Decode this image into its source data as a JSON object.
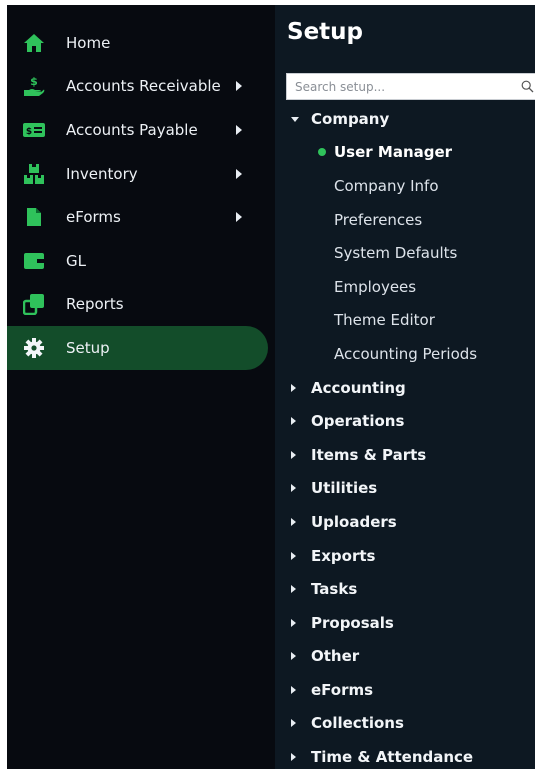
{
  "colors": {
    "accent": "#2fc25b",
    "sidebar_bg": "#070a10",
    "main_bg": "#0d1822",
    "active_item_bg": "#134d2a"
  },
  "sidebar": {
    "items": [
      {
        "label": "Home",
        "icon": "home-icon",
        "has_submenu": false,
        "active": false
      },
      {
        "label": "Accounts Receivable",
        "icon": "hand-dollar-icon",
        "has_submenu": true,
        "active": false
      },
      {
        "label": "Accounts Payable",
        "icon": "money-bill-icon",
        "has_submenu": true,
        "active": false
      },
      {
        "label": "Inventory",
        "icon": "boxes-icon",
        "has_submenu": true,
        "active": false
      },
      {
        "label": "eForms",
        "icon": "file-icon",
        "has_submenu": true,
        "active": false
      },
      {
        "label": "GL",
        "icon": "wallet-icon",
        "has_submenu": false,
        "active": false
      },
      {
        "label": "Reports",
        "icon": "reports-icon",
        "has_submenu": false,
        "active": false
      },
      {
        "label": "Setup",
        "icon": "gear-icon",
        "has_submenu": false,
        "active": true
      }
    ]
  },
  "main": {
    "title": "Setup",
    "search": {
      "placeholder": "Search setup...",
      "value": ""
    },
    "tree": [
      {
        "label": "Company",
        "expanded": true,
        "children": [
          {
            "label": "User Manager",
            "active": true
          },
          {
            "label": "Company Info",
            "active": false
          },
          {
            "label": "Preferences",
            "active": false
          },
          {
            "label": "System Defaults",
            "active": false
          },
          {
            "label": "Employees",
            "active": false
          },
          {
            "label": "Theme Editor",
            "active": false
          },
          {
            "label": "Accounting Periods",
            "active": false
          }
        ]
      },
      {
        "label": "Accounting",
        "expanded": false
      },
      {
        "label": "Operations",
        "expanded": false
      },
      {
        "label": "Items & Parts",
        "expanded": false
      },
      {
        "label": "Utilities",
        "expanded": false
      },
      {
        "label": "Uploaders",
        "expanded": false
      },
      {
        "label": "Exports",
        "expanded": false
      },
      {
        "label": "Tasks",
        "expanded": false
      },
      {
        "label": "Proposals",
        "expanded": false
      },
      {
        "label": "Other",
        "expanded": false
      },
      {
        "label": "eForms",
        "expanded": false
      },
      {
        "label": "Collections",
        "expanded": false
      },
      {
        "label": "Time & Attendance",
        "expanded": false
      }
    ]
  }
}
